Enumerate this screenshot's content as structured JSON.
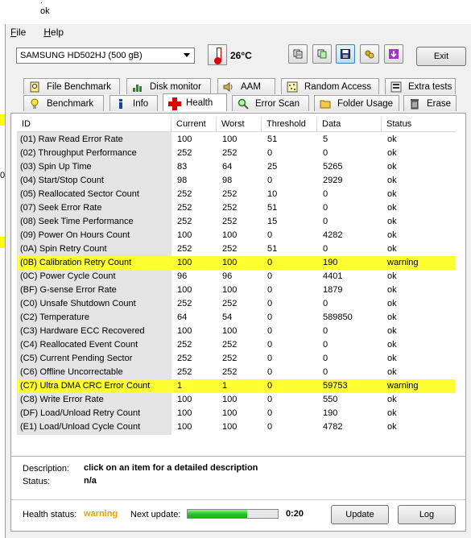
{
  "background": {
    "line1": "ok",
    "line2": "0"
  },
  "menu": {
    "file": "File",
    "file_ul": "F",
    "file_rest": "ile",
    "help_ul": "H",
    "help_rest": "elp"
  },
  "toolbar": {
    "drive": "SAMSUNG HD502HJ (500 gB)",
    "temperature": "26°C",
    "exit": "Exit"
  },
  "tabs_top": [
    "File Benchmark",
    "Disk monitor",
    "AAM",
    "Random Access",
    "Extra tests"
  ],
  "tabs_bottom": [
    "Benchmark",
    "Info",
    "Health",
    "Error Scan",
    "Folder Usage",
    "Erase"
  ],
  "active_tab": "Health",
  "table": {
    "columns": [
      "ID",
      "Current",
      "Worst",
      "Threshold",
      "Data",
      "Status"
    ],
    "rows": [
      [
        "(01) Raw Read Error Rate",
        "100",
        "100",
        "51",
        "5",
        "ok"
      ],
      [
        "(02) Throughput Performance",
        "252",
        "252",
        "0",
        "0",
        "ok"
      ],
      [
        "(03) Spin Up Time",
        "83",
        "64",
        "25",
        "5265",
        "ok"
      ],
      [
        "(04) Start/Stop Count",
        "98",
        "98",
        "0",
        "2929",
        "ok"
      ],
      [
        "(05) Reallocated Sector Count",
        "252",
        "252",
        "10",
        "0",
        "ok"
      ],
      [
        "(07) Seek Error Rate",
        "252",
        "252",
        "51",
        "0",
        "ok"
      ],
      [
        "(08) Seek Time Performance",
        "252",
        "252",
        "15",
        "0",
        "ok"
      ],
      [
        "(09) Power On Hours Count",
        "100",
        "100",
        "0",
        "4282",
        "ok"
      ],
      [
        "(0A) Spin Retry Count",
        "252",
        "252",
        "51",
        "0",
        "ok"
      ],
      [
        "(0B) Calibration Retry Count",
        "100",
        "100",
        "0",
        "190",
        "warning"
      ],
      [
        "(0C) Power Cycle Count",
        "96",
        "96",
        "0",
        "4401",
        "ok"
      ],
      [
        "(BF) G-sense Error Rate",
        "100",
        "100",
        "0",
        "1879",
        "ok"
      ],
      [
        "(C0) Unsafe Shutdown Count",
        "252",
        "252",
        "0",
        "0",
        "ok"
      ],
      [
        "(C2) Temperature",
        "64",
        "54",
        "0",
        "589850",
        "ok"
      ],
      [
        "(C3) Hardware ECC Recovered",
        "100",
        "100",
        "0",
        "0",
        "ok"
      ],
      [
        "(C4) Reallocated Event Count",
        "252",
        "252",
        "0",
        "0",
        "ok"
      ],
      [
        "(C5) Current Pending Sector",
        "252",
        "252",
        "0",
        "0",
        "ok"
      ],
      [
        "(C6) Offline Uncorrectable",
        "252",
        "252",
        "0",
        "0",
        "ok"
      ],
      [
        "(C7) Ultra DMA CRC Error Count",
        "1",
        "1",
        "0",
        "59753",
        "warning"
      ],
      [
        "(C8) Write Error Rate",
        "100",
        "100",
        "0",
        "550",
        "ok"
      ],
      [
        "(DF) Load/Unload Retry Count",
        "100",
        "100",
        "0",
        "190",
        "ok"
      ],
      [
        "(E1) Load/Unload Cycle Count",
        "100",
        "100",
        "0",
        "4782",
        "ok"
      ]
    ]
  },
  "description": {
    "label": "Description:",
    "value": "click on an item for a detailed description"
  },
  "status": {
    "label": "Status:",
    "value": "n/a"
  },
  "footer": {
    "health_label": "Health status:",
    "health_value": "warning",
    "health_color": "#e8a000",
    "next_label": "Next update:",
    "progress": 0.66,
    "countdown": "0:20",
    "update": "Update",
    "log": "Log"
  },
  "colors": {
    "warning_row": "#ffff33",
    "id_column": "#e4e4e4"
  }
}
